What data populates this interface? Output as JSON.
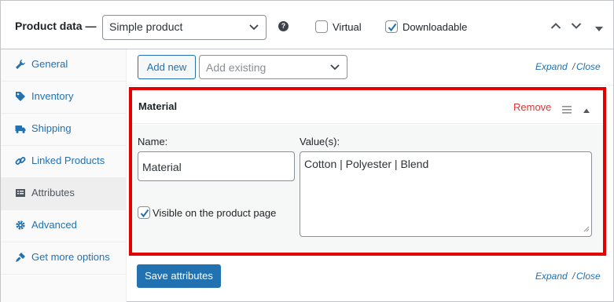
{
  "header": {
    "title": "Product data —",
    "product_type": "Simple product",
    "help_icon": "help-icon",
    "virtual_label": "Virtual",
    "virtual_checked": false,
    "downloadable_label": "Downloadable",
    "downloadable_checked": true
  },
  "sidebar": {
    "items": [
      {
        "label": "General",
        "icon": "wrench-icon"
      },
      {
        "label": "Inventory",
        "icon": "tag-icon"
      },
      {
        "label": "Shipping",
        "icon": "truck-icon"
      },
      {
        "label": "Linked Products",
        "icon": "link-icon"
      },
      {
        "label": "Attributes",
        "icon": "list-icon",
        "active": true
      },
      {
        "label": "Advanced",
        "icon": "gear-icon"
      },
      {
        "label": "Get more options",
        "icon": "plugin-icon"
      }
    ]
  },
  "toolbar": {
    "add_new_label": "Add new",
    "add_existing_placeholder": "Add existing",
    "expand_label": "Expand",
    "separator": "/",
    "close_label": "Close"
  },
  "attribute": {
    "heading": "Material",
    "remove_label": "Remove",
    "name_label": "Name:",
    "name_value": "Material",
    "values_label": "Value(s):",
    "values_value": "Cotton | Polyester | Blend",
    "visible_label": "Visible on the product page",
    "visible_checked": true
  },
  "footer": {
    "save_label": "Save attributes",
    "expand_label": "Expand",
    "separator": "/",
    "close_label": "Close"
  },
  "colors": {
    "accent": "#2271b1",
    "highlight_border": "#e40000",
    "remove": "#d63638"
  }
}
